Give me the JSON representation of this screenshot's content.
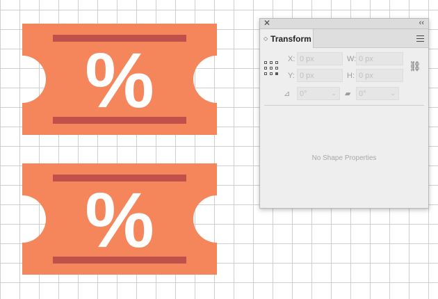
{
  "canvas": {
    "ticket_fill": "#F5855A",
    "stripe_fill": "#C0504A",
    "ticket_glyph": "%"
  },
  "panel": {
    "close_glyph": "✕",
    "collapse_glyph": "‹‹",
    "tab_title": "Transform",
    "tab_icon": "◇",
    "x_label": "X:",
    "x_value": "0 px",
    "y_label": "Y:",
    "y_value": "0 px",
    "w_label": "W:",
    "w_value": "0 px",
    "h_label": "H:",
    "h_value": "0 px",
    "rotate_icon_glyph": "⊿",
    "rotate_value": "0°",
    "shear_icon_glyph": "▰",
    "shear_value": "0°",
    "link_glyph": "⛓",
    "empty_message": "No Shape Properties"
  }
}
